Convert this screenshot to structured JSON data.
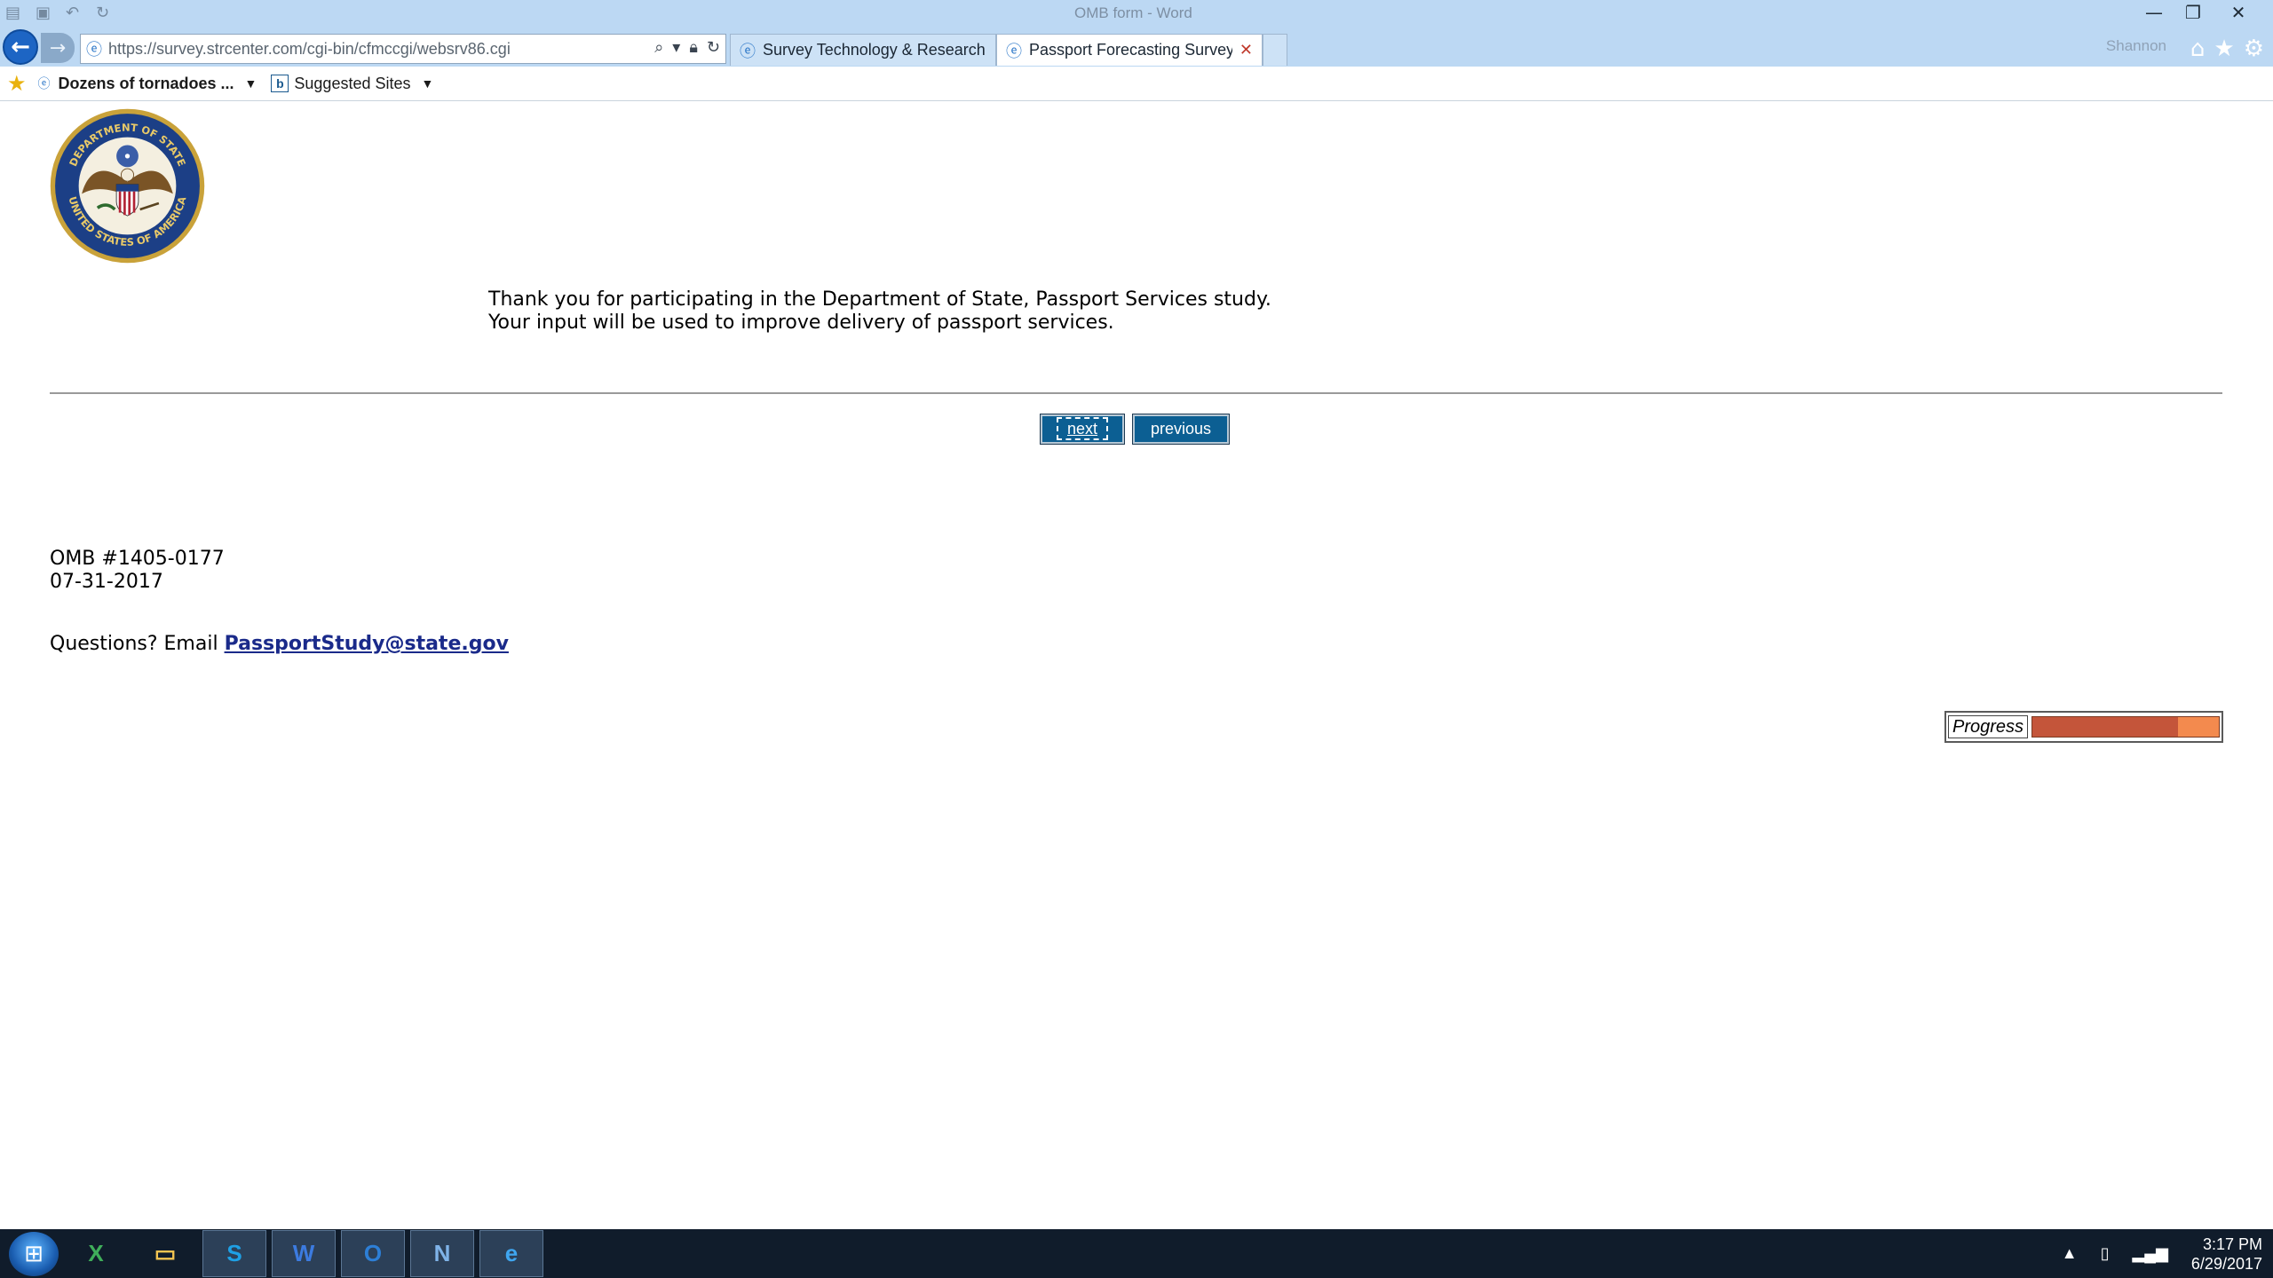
{
  "browser": {
    "ghost_title": "OMB form - Word",
    "ghost_user": "Shannon",
    "address_url": "https://survey.strcenter.com/cgi-bin/cfmccgi/websrv86.cgi",
    "tabs": [
      {
        "label": "Survey Technology & Research ..."
      },
      {
        "label": "Passport Forecasting Survey"
      }
    ],
    "favorites": [
      {
        "label": "Dozens of tornadoes ..."
      },
      {
        "label": "Suggested Sites"
      }
    ]
  },
  "page": {
    "thanks_line1": "Thank you for participating in the Department of State, Passport Services study.",
    "thanks_line2": "Your input will be used to improve delivery of passport services.",
    "next_label": "next",
    "previous_label": "previous",
    "omb_number": "OMB #1405-0177",
    "omb_date": "07-31-2017",
    "questions_prefix": "Questions? Email ",
    "questions_email": "PassportStudy@state.gov",
    "progress_label": "Progress",
    "progress_fraction": 0.78
  },
  "seal": {
    "text_top": "DEPARTMENT OF STATE",
    "text_bottom": "UNITED STATES OF AMERICA"
  },
  "taskbar": {
    "apps": [
      "excel-icon",
      "file-explorer-icon",
      "skype-icon",
      "word-icon",
      "outlook-icon",
      "app-n-icon",
      "internet-explorer-icon"
    ],
    "clock_time": "3:17 PM",
    "clock_date": "6/29/2017"
  },
  "colors": {
    "button_blue": "#0c5f93",
    "progress_fill": "#c4553a",
    "progress_track": "#f38a4e",
    "link": "#1a2a8a"
  }
}
